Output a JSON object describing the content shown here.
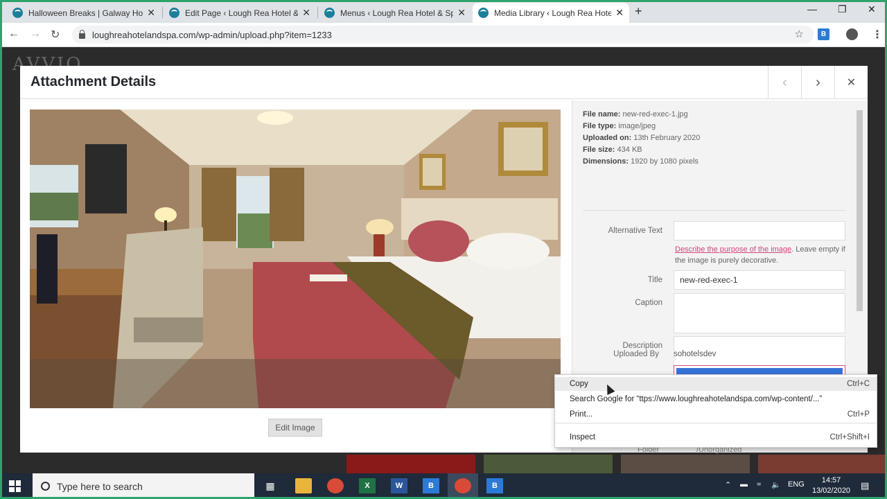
{
  "browser": {
    "tabs": [
      {
        "title": "Halloween Breaks | Galway Hote",
        "active": false
      },
      {
        "title": "Edit Page ‹ Lough Rea Hotel & Sp",
        "active": false
      },
      {
        "title": "Menus ‹ Lough Rea Hotel & Spa",
        "active": false
      },
      {
        "title": "Media Library ‹ Lough Rea Hotel",
        "active": true
      }
    ],
    "url": "loughreahotelandspa.com/wp-admin/upload.php?item=1233",
    "new_tab": "+",
    "close": "✕"
  },
  "backdrop": {
    "logo": "AVVIO"
  },
  "modal": {
    "title": "Attachment Details",
    "prev": "‹",
    "next": "›",
    "close": "✕",
    "edit_image_label": "Edit Image"
  },
  "file_meta": {
    "file_name_label": "File name:",
    "file_name": "new-red-exec-1.jpg",
    "file_type_label": "File type:",
    "file_type": "image/jpeg",
    "uploaded_on_label": "Uploaded on:",
    "uploaded_on": "13th February 2020",
    "file_size_label": "File size:",
    "file_size": "434 KB",
    "dimensions_label": "Dimensions:",
    "dimensions": "1920 by 1080 pixels"
  },
  "fields": {
    "alt_text_label": "Alternative Text",
    "alt_text_value": "",
    "alt_help_link": "Describe the purpose of the image",
    "alt_help_rest": ". Leave empty if the image is purely decorative.",
    "title_label": "Title",
    "title_value": "new-red-exec-1",
    "caption_label": "Caption",
    "caption_value": "",
    "description_label": "Description",
    "description_value": "",
    "uploaded_by_label": "Uploaded By",
    "uploaded_by_value": "sohotelsdev",
    "folder_label": "Folder",
    "folder_value": "/Unorganized"
  },
  "context_menu": {
    "items": [
      {
        "label": "Copy",
        "shortcut": "Ctrl+C"
      },
      {
        "label": "Search Google for “ttps://www.loughreahotelandspa.com/wp-content/...”",
        "shortcut": ""
      },
      {
        "label": "Print...",
        "shortcut": "Ctrl+P"
      },
      {
        "label": "Inspect",
        "shortcut": "Ctrl+Shift+I"
      }
    ]
  },
  "taskbar": {
    "search_placeholder": "Type here to search",
    "language": "ENG",
    "time": "14:57",
    "date": "13/02/2020"
  },
  "colors": {
    "accent_border": "#2fa36b",
    "link_pink": "#d0457f",
    "selection_blue": "#3874d8"
  }
}
